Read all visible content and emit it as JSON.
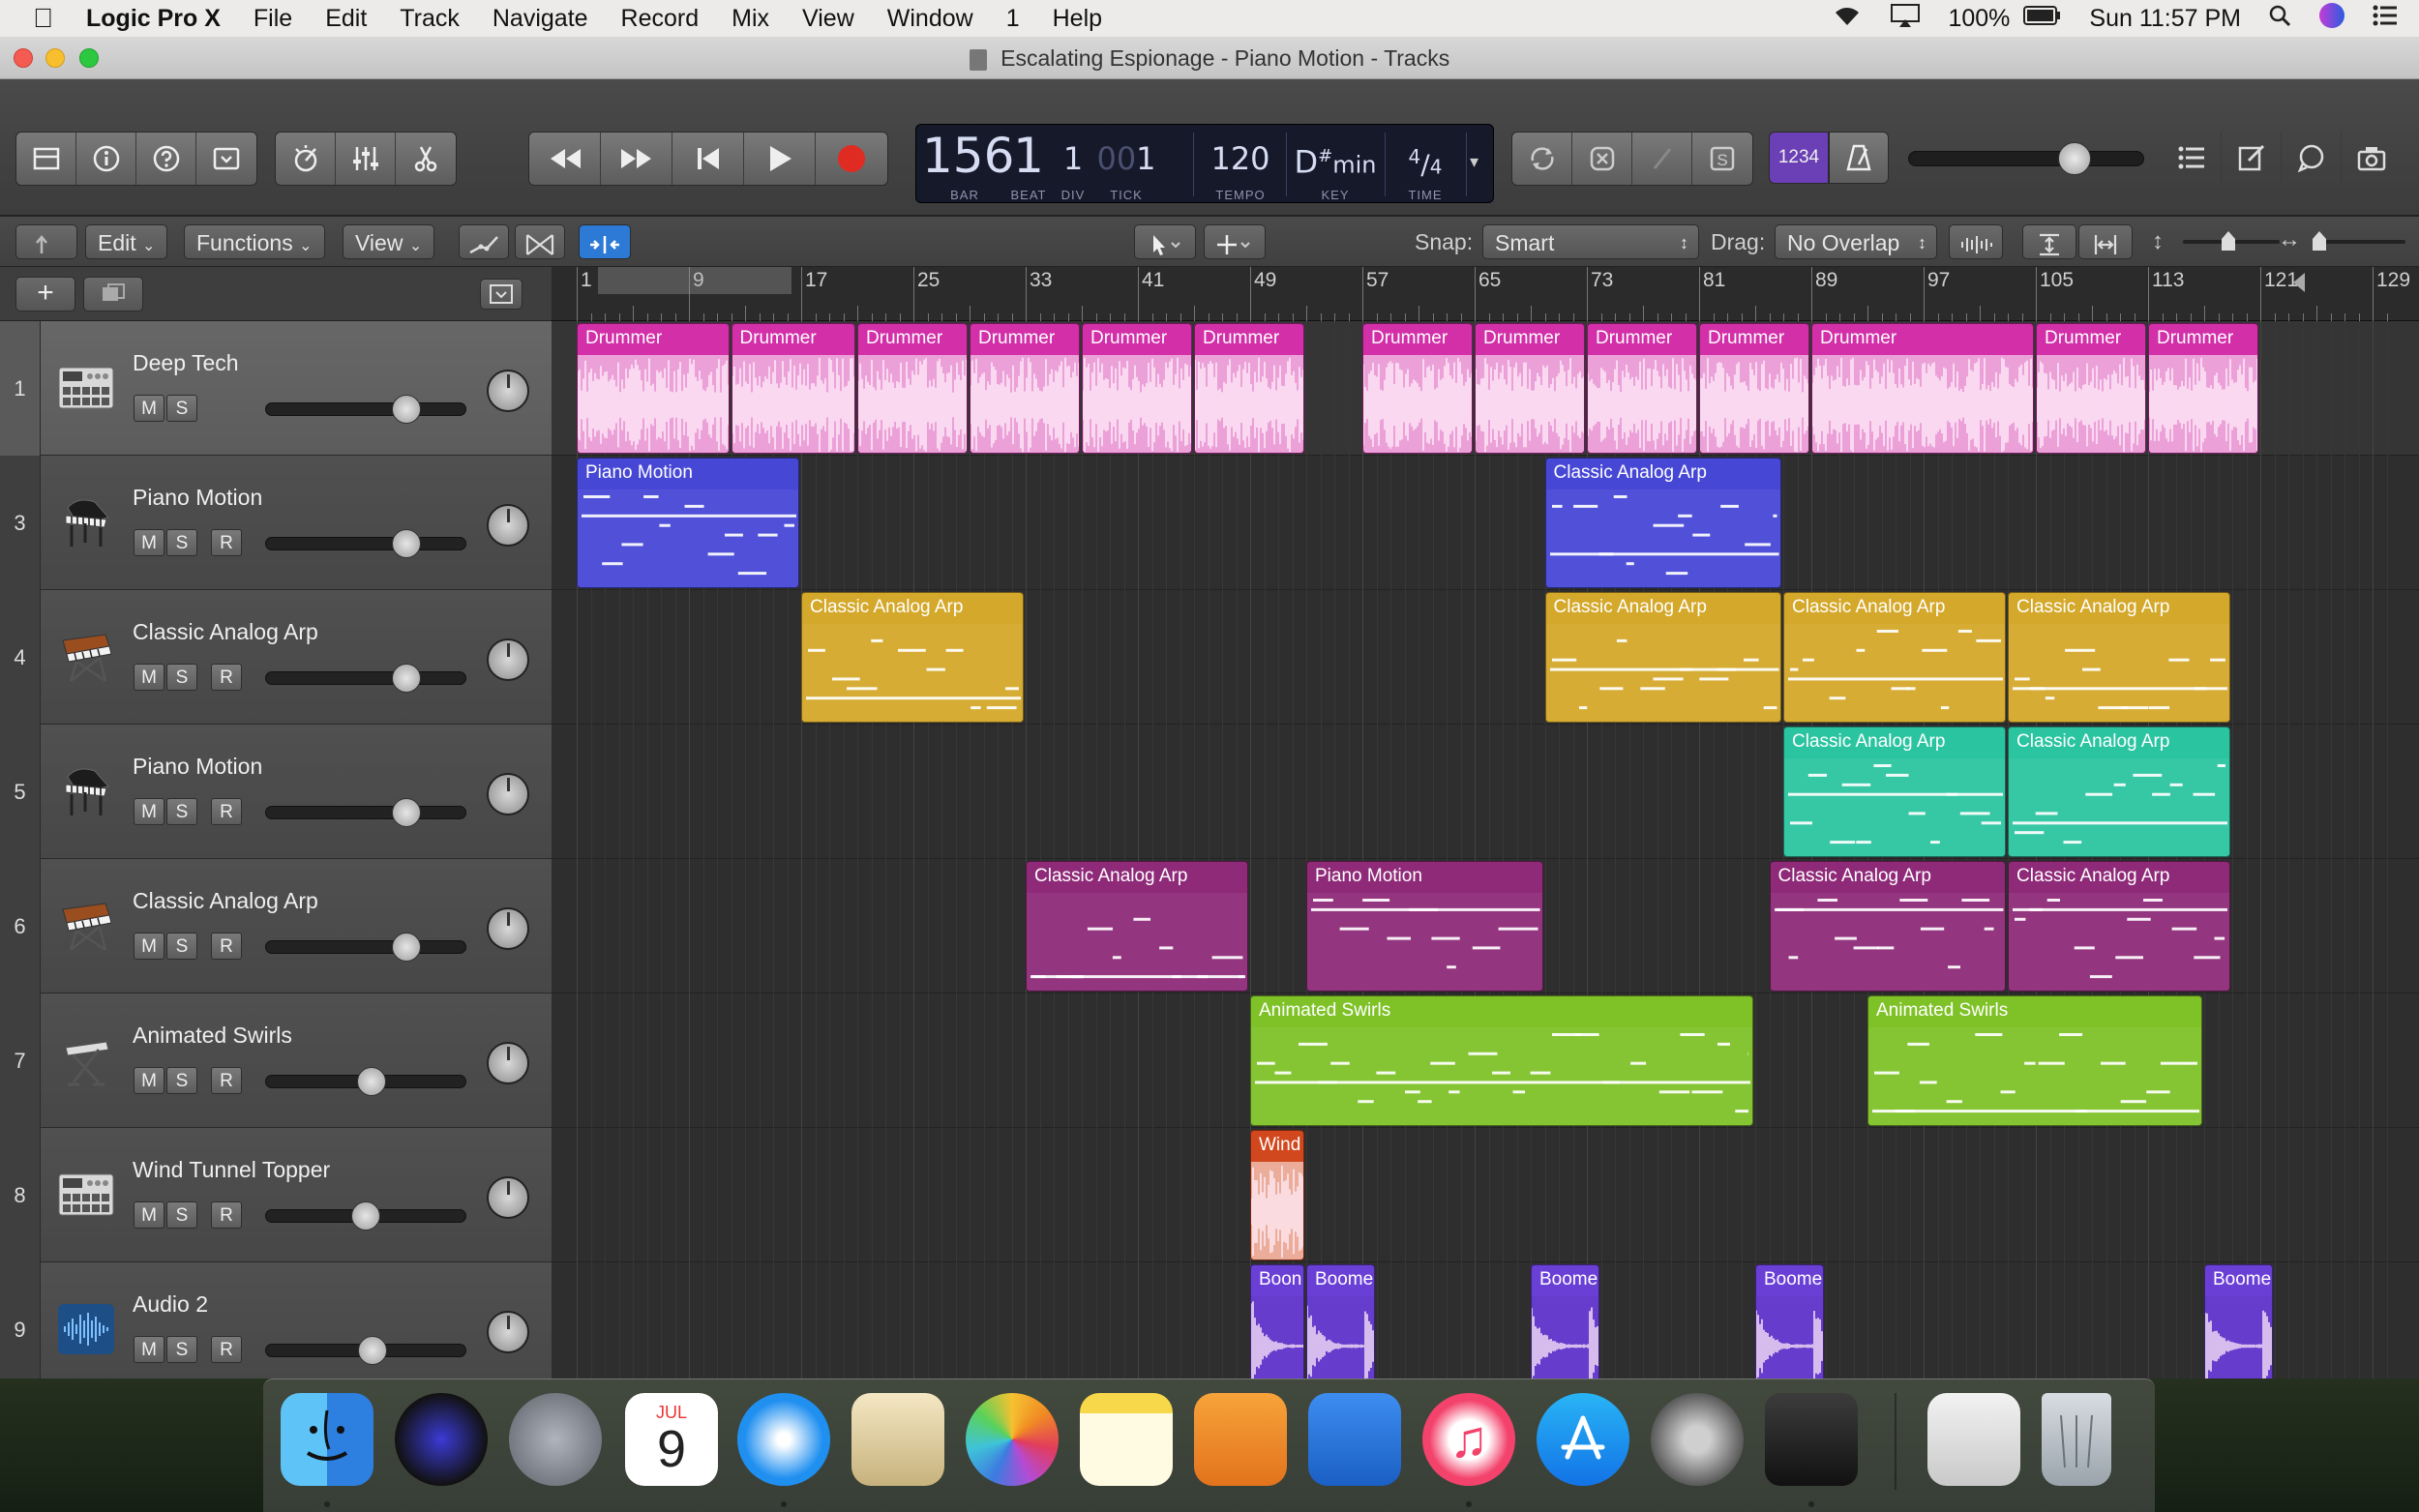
{
  "menubar": {
    "app_name": "Logic Pro X",
    "items": [
      "File",
      "Edit",
      "Track",
      "Navigate",
      "Record",
      "Mix",
      "View",
      "Window",
      "1",
      "Help"
    ],
    "battery": "100%",
    "clock": "Sun 11:57 PM"
  },
  "window": {
    "title": "Escalating Espionage - Piano Motion - Tracks"
  },
  "lcd": {
    "bar": "156",
    "bar_label": "BAR",
    "beat": "1",
    "beat_label": "BEAT",
    "div": "1",
    "div_label": "DIV",
    "tick": "1",
    "tick_prefix": "00",
    "tick_label": "TICK",
    "tempo": "120",
    "tempo_label": "TEMPO",
    "key_note": "D",
    "key_accidental": "#",
    "key_mode": "min",
    "key_label": "KEY",
    "time_num": "4",
    "time_den": "4",
    "time_label": "TIME"
  },
  "toolbar": {
    "count_in_label": "1234"
  },
  "editbar": {
    "edit_label": "Edit",
    "functions_label": "Functions",
    "view_label": "View",
    "snap_label": "Snap:",
    "snap_value": "Smart",
    "drag_label": "Drag:",
    "drag_value": "No Overlap"
  },
  "ruler": [
    "1",
    "9",
    "17",
    "25",
    "33",
    "41",
    "49",
    "57",
    "65",
    "73",
    "81",
    "89",
    "97",
    "105",
    "113",
    "121",
    "129"
  ],
  "tracks": [
    {
      "num": "1",
      "name": "Deep Tech",
      "icon": "drum-machine-icon",
      "has_r": false,
      "vol": 0.72,
      "selected": true
    },
    {
      "num": "3",
      "name": "Piano Motion",
      "icon": "grand-piano-icon",
      "has_r": true,
      "vol": 0.72,
      "selected": false
    },
    {
      "num": "4",
      "name": "Classic Analog Arp",
      "icon": "synth-keyboard-icon",
      "has_r": true,
      "vol": 0.72,
      "selected": false
    },
    {
      "num": "5",
      "name": "Piano Motion",
      "icon": "grand-piano-icon",
      "has_r": true,
      "vol": 0.72,
      "selected": false
    },
    {
      "num": "6",
      "name": "Classic Analog Arp",
      "icon": "synth-keyboard-icon",
      "has_r": true,
      "vol": 0.72,
      "selected": false
    },
    {
      "num": "7",
      "name": "Animated Swirls",
      "icon": "keyboard-stand-icon",
      "has_r": true,
      "vol": 0.52,
      "selected": false
    },
    {
      "num": "8",
      "name": "Wind Tunnel Topper",
      "icon": "drum-machine-icon",
      "has_r": true,
      "vol": 0.49,
      "selected": false
    },
    {
      "num": "9",
      "name": "Audio 2",
      "icon": "waveform-icon",
      "has_r": true,
      "vol": 0.53,
      "selected": false
    }
  ],
  "regions": [
    {
      "lane": 0,
      "start": 1,
      "end": 12,
      "label": "Drummer",
      "color": "#d22fa8",
      "kind": "audio"
    },
    {
      "lane": 0,
      "start": 12,
      "end": 21,
      "label": "Drummer",
      "color": "#d22fa8",
      "kind": "audio"
    },
    {
      "lane": 0,
      "start": 21,
      "end": 29,
      "label": "Drummer",
      "color": "#d22fa8",
      "kind": "audio"
    },
    {
      "lane": 0,
      "start": 29,
      "end": 37,
      "label": "Drummer",
      "color": "#d22fa8",
      "kind": "audio"
    },
    {
      "lane": 0,
      "start": 37,
      "end": 45,
      "label": "Drummer",
      "color": "#d22fa8",
      "kind": "audio"
    },
    {
      "lane": 0,
      "start": 45,
      "end": 53,
      "label": "Drummer",
      "color": "#d22fa8",
      "kind": "audio"
    },
    {
      "lane": 0,
      "start": 57,
      "end": 65,
      "label": "Drummer",
      "color": "#d22fa8",
      "kind": "audio"
    },
    {
      "lane": 0,
      "start": 65,
      "end": 73,
      "label": "Drummer",
      "color": "#d22fa8",
      "kind": "audio"
    },
    {
      "lane": 0,
      "start": 73,
      "end": 81,
      "label": "Drummer",
      "color": "#d22fa8",
      "kind": "audio"
    },
    {
      "lane": 0,
      "start": 81,
      "end": 89,
      "label": "Drummer",
      "color": "#d22fa8",
      "kind": "audio"
    },
    {
      "lane": 0,
      "start": 89,
      "end": 105,
      "label": "Drummer",
      "color": "#d22fa8",
      "kind": "audio"
    },
    {
      "lane": 0,
      "start": 105,
      "end": 113,
      "label": "Drummer",
      "color": "#d22fa8",
      "kind": "audio"
    },
    {
      "lane": 0,
      "start": 113,
      "end": 121,
      "label": "Drummer",
      "color": "#d22fa8",
      "kind": "audio"
    },
    {
      "lane": 1,
      "start": 1,
      "end": 17,
      "label": "Piano Motion",
      "color": "#4747d6",
      "kind": "midi"
    },
    {
      "lane": 1,
      "start": 70,
      "end": 87,
      "label": "Classic Analog Arp",
      "color": "#4747d6",
      "kind": "midi"
    },
    {
      "lane": 2,
      "start": 17,
      "end": 33,
      "label": "Classic Analog Arp",
      "color": "#d4a82a",
      "kind": "midi"
    },
    {
      "lane": 2,
      "start": 70,
      "end": 87,
      "label": "Classic Analog Arp",
      "color": "#d4a82a",
      "kind": "midi"
    },
    {
      "lane": 2,
      "start": 87,
      "end": 103,
      "label": "Classic Analog Arp",
      "color": "#d4a82a",
      "kind": "midi"
    },
    {
      "lane": 2,
      "start": 103,
      "end": 119,
      "label": "Classic Analog Arp",
      "color": "#d4a82a",
      "kind": "midi"
    },
    {
      "lane": 3,
      "start": 87,
      "end": 103,
      "label": "Classic Analog Arp",
      "color": "#2bc4a0",
      "kind": "midi"
    },
    {
      "lane": 3,
      "start": 103,
      "end": 119,
      "label": "Classic Analog Arp",
      "color": "#2bc4a0",
      "kind": "midi"
    },
    {
      "lane": 4,
      "start": 33,
      "end": 49,
      "label": "Classic Analog Arp",
      "color": "#8e2a78",
      "kind": "midi"
    },
    {
      "lane": 4,
      "start": 53,
      "end": 70,
      "label": "Piano Motion",
      "color": "#8e2a78",
      "kind": "midi"
    },
    {
      "lane": 4,
      "start": 86,
      "end": 103,
      "label": "Classic Analog Arp",
      "color": "#8e2a78",
      "kind": "midi"
    },
    {
      "lane": 4,
      "start": 103,
      "end": 119,
      "label": "Classic Analog Arp",
      "color": "#8e2a78",
      "kind": "midi"
    },
    {
      "lane": 5,
      "start": 49,
      "end": 85,
      "label": "Animated Swirls",
      "color": "#7fc228",
      "kind": "midi"
    },
    {
      "lane": 5,
      "start": 93,
      "end": 117,
      "label": "Animated Swirls",
      "color": "#7fc228",
      "kind": "midi"
    },
    {
      "lane": 6,
      "start": 49,
      "end": 53,
      "label": "Wind",
      "color": "#d2481e",
      "kind": "audio"
    },
    {
      "lane": 7,
      "start": 49,
      "end": 53,
      "label": "Boon",
      "color": "#6a3fd6",
      "kind": "audio"
    },
    {
      "lane": 7,
      "start": 53,
      "end": 58,
      "label": "Boome",
      "color": "#6a3fd6",
      "kind": "audio"
    },
    {
      "lane": 7,
      "start": 69,
      "end": 74,
      "label": "Boome",
      "color": "#6a3fd6",
      "kind": "audio"
    },
    {
      "lane": 7,
      "start": 85,
      "end": 90,
      "label": "Boome",
      "color": "#6a3fd6",
      "kind": "audio"
    },
    {
      "lane": 7,
      "start": 117,
      "end": 122,
      "label": "Boome",
      "color": "#6a3fd6",
      "kind": "audio"
    }
  ],
  "dock": {
    "calendar_month": "JUL",
    "calendar_day": "9",
    "apps": [
      "finder-icon",
      "siri-icon",
      "launchpad-icon",
      "calendar-icon",
      "safari-icon",
      "mail-icon",
      "photos-icon",
      "notes-icon",
      "pages-icon",
      "keynote-icon",
      "itunes-icon",
      "app-store-icon",
      "system-preferences-icon",
      "logic-pro-icon",
      "screenshot-icon",
      "trash-icon"
    ]
  }
}
